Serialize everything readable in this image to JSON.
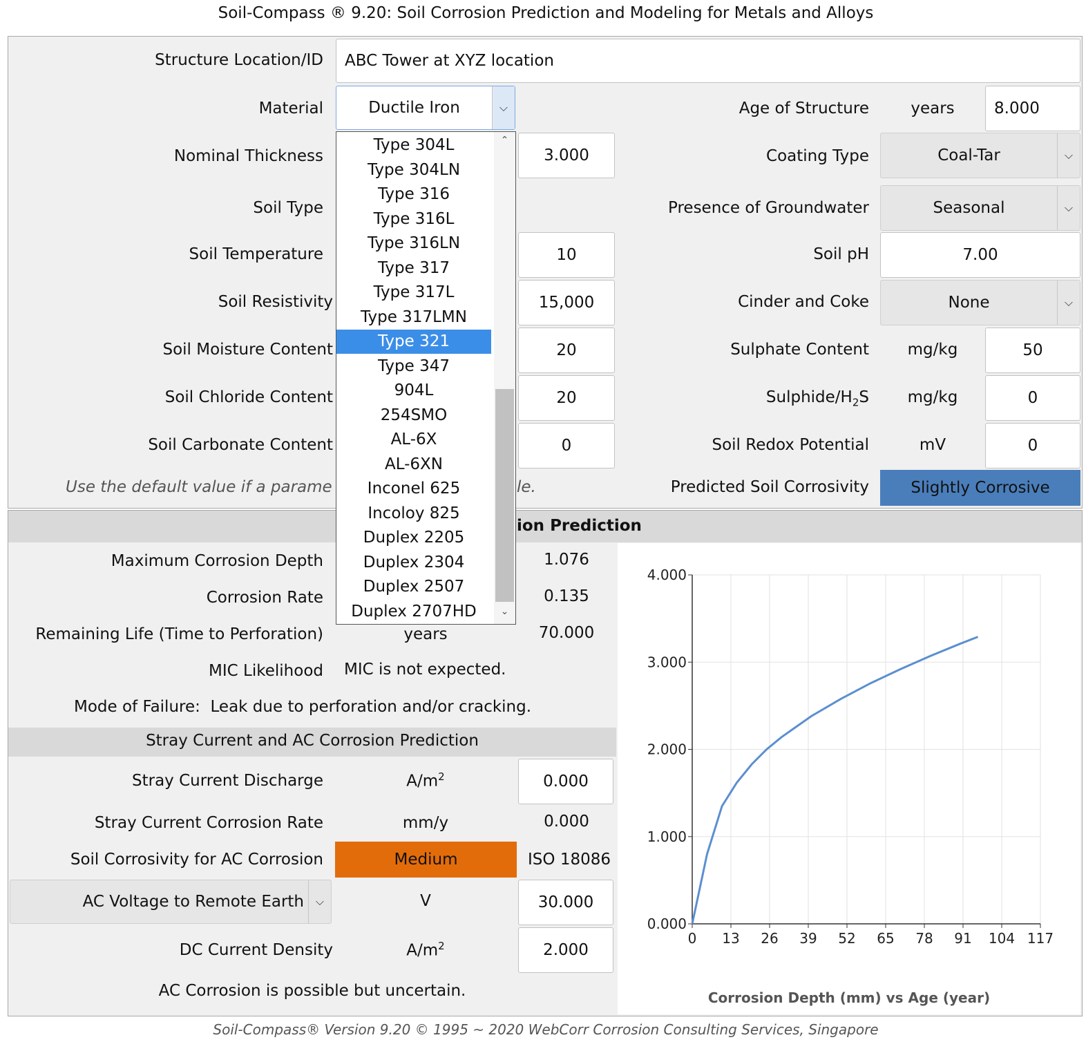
{
  "app": {
    "title": "Soil-Compass ® 9.20: Soil Corrosion Prediction and Modeling for Metals and Alloys",
    "footer": "Soil-Compass® Version 9.20 © 1995 ~ 2020 WebCorr Corrosion Consulting Services, Singapore"
  },
  "inputs": {
    "structure_label": "Structure Location/ID",
    "structure_value": "ABC Tower at XYZ location",
    "material_label": "Material",
    "material_value": "Ductile Iron",
    "material_options": [
      "Type 304L",
      "Type 304LN",
      "Type 316",
      "Type 316L",
      "Type 316LN",
      "Type 317",
      "Type 317L",
      "Type 317LMN",
      "Type 321",
      "Type 347",
      "904L",
      "254SMO",
      "AL-6X",
      "AL-6XN",
      "Inconel 625",
      "Incoloy 825",
      "Duplex 2205",
      "Duplex 2304",
      "Duplex 2507",
      "Duplex 2707HD"
    ],
    "material_highlighted": "Type 321",
    "thickness_label": "Nominal Thickness",
    "thickness_value": "3.000",
    "soil_type_label": "Soil Type",
    "soil_temp_label": "Soil Temperature",
    "soil_temp_value": "10",
    "soil_resistivity_label": "Soil Resistivity",
    "soil_resistivity_value": "15,000",
    "soil_moisture_label": "Soil Moisture Content",
    "soil_moisture_value": "20",
    "soil_chloride_label": "Soil Chloride Content",
    "soil_chloride_value": "20",
    "soil_carbonate_label": "Soil Carbonate Content",
    "soil_carbonate_value": "0",
    "hint_left": "Use the default value if a parame",
    "hint_right": "le.",
    "age_label": "Age of Structure",
    "age_unit": "years",
    "age_value": "8.000",
    "coating_label": "Coating Type",
    "coating_value": "Coal-Tar",
    "groundwater_label": "Presence of Groundwater",
    "groundwater_value": "Seasonal",
    "ph_label": "Soil pH",
    "ph_value": "7.00",
    "cinder_label": "Cinder and Coke",
    "cinder_value": "None",
    "sulphate_label": "Sulphate Content",
    "sulphate_unit": "mg/kg",
    "sulphate_value": "50",
    "sulphide_label_main": "Sulphide/H",
    "sulphide_label_sub": "2",
    "sulphide_label_end": "S",
    "sulphide_unit": "mg/kg",
    "sulphide_value": "0",
    "redox_label": "Soil Redox Potential",
    "redox_unit": "mV",
    "redox_value": "0",
    "corrosivity_label": "Predicted Soil Corrosivity",
    "corrosivity_value": "Slightly Corrosive",
    "corrosivity_color": "#4a7ebb"
  },
  "prediction": {
    "header_visible": "ion Prediction",
    "max_depth_label": "Maximum Corrosion Depth",
    "max_depth_value": "1.076",
    "rate_label": "Corrosion Rate",
    "rate_value": "0.135",
    "life_label": "Remaining Life (Time to Perforation)",
    "life_unit": "years",
    "life_value": "70.000",
    "mic_label": "MIC Likelihood",
    "mic_value": "MIC is not expected.",
    "failure_label": "Mode of Failure:",
    "failure_value": "Leak due to perforation and/or cracking."
  },
  "stray": {
    "header": "Stray Current and AC Corrosion Prediction",
    "discharge_label": "Stray Current Discharge",
    "discharge_unit": "A/m",
    "discharge_unit_sup": "2",
    "discharge_value": "0.000",
    "rate_label": "Stray Current Corrosion Rate",
    "rate_unit": "mm/y",
    "rate_value": "0.000",
    "ac_corrosivity_label": "Soil Corrosivity for AC Corrosion",
    "ac_corrosivity_value": "Medium",
    "ac_corrosivity_color": "#e36c0a",
    "standard": "ISO 18086",
    "ac_voltage_label": "AC Voltage to Remote Earth",
    "ac_voltage_unit": "V",
    "ac_voltage_value": "30.000",
    "dc_density_label": "DC Current Density",
    "dc_density_unit": "A/m",
    "dc_density_unit_sup": "2",
    "dc_density_value": "2.000",
    "conclusion": "AC Corrosion is possible but uncertain."
  },
  "chart_data": {
    "type": "line",
    "title": "Corrosion Depth (mm) vs Age (year)",
    "x_ticks": [
      "0",
      "13",
      "26",
      "39",
      "52",
      "65",
      "78",
      "91",
      "104",
      "117"
    ],
    "y_ticks": [
      "0.000",
      "1.000",
      "2.000",
      "3.000",
      "4.000"
    ],
    "xlim": [
      0,
      117
    ],
    "ylim": [
      0,
      4
    ],
    "grid": true,
    "line_color": "#5b8fd0",
    "series": [
      {
        "x": [
          0,
          5,
          10,
          15,
          20,
          25,
          30,
          40,
          50,
          60,
          70,
          80,
          90,
          96
        ],
        "y": [
          0,
          0.8,
          1.35,
          1.62,
          1.83,
          2.0,
          2.14,
          2.38,
          2.58,
          2.76,
          2.92,
          3.07,
          3.21,
          3.29
        ]
      }
    ]
  }
}
